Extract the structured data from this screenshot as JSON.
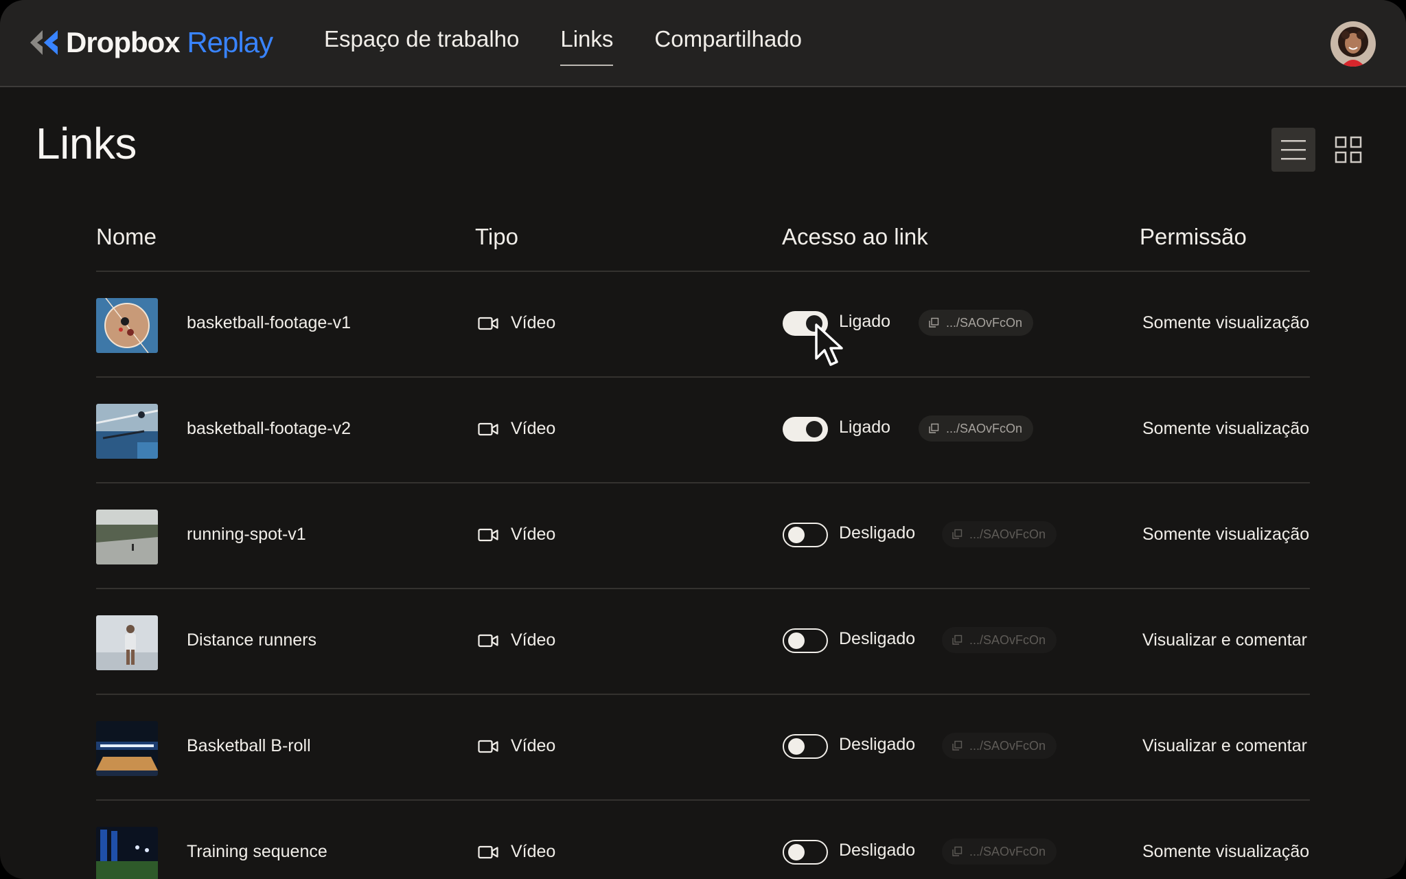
{
  "brand": {
    "name": "Dropbox",
    "product": "Replay",
    "accent": "#3984ff"
  },
  "nav": {
    "items": [
      {
        "label": "Espaço de trabalho",
        "active": false
      },
      {
        "label": "Links",
        "active": true
      },
      {
        "label": "Compartilhado",
        "active": false
      }
    ]
  },
  "page": {
    "title": "Links",
    "view_mode": "list"
  },
  "table": {
    "headers": {
      "name": "Nome",
      "type": "Tipo",
      "access": "Acesso ao link",
      "permission": "Permissão"
    },
    "rows": [
      {
        "name": "basketball-footage-v1",
        "type": "Vídeo",
        "type_icon": "video-camera-icon",
        "access_on": true,
        "status": "Ligado",
        "link": ".../SAOvFcOn",
        "permission": "Somente visualização"
      },
      {
        "name": "basketball-footage-v2",
        "type": "Vídeo",
        "type_icon": "video-camera-icon",
        "access_on": true,
        "status": "Ligado",
        "link": ".../SAOvFcOn",
        "permission": "Somente visualização"
      },
      {
        "name": "running-spot-v1",
        "type": "Vídeo",
        "type_icon": "video-camera-icon",
        "access_on": false,
        "status": "Desligado",
        "link": ".../SAOvFcOn",
        "permission": "Somente visualização"
      },
      {
        "name": "Distance runners",
        "type": "Vídeo",
        "type_icon": "video-camera-icon",
        "access_on": false,
        "status": "Desligado",
        "link": ".../SAOvFcOn",
        "permission": "Visualizar e comentar"
      },
      {
        "name": "Basketball B-roll",
        "type": "Vídeo",
        "type_icon": "video-camera-icon",
        "access_on": false,
        "status": "Desligado",
        "link": ".../SAOvFcOn",
        "permission": "Visualizar e comentar"
      },
      {
        "name": "Training sequence",
        "type": "Vídeo",
        "type_icon": "video-camera-icon",
        "access_on": false,
        "status": "Desligado",
        "link": ".../SAOvFcOn",
        "permission": "Somente visualização"
      }
    ]
  }
}
